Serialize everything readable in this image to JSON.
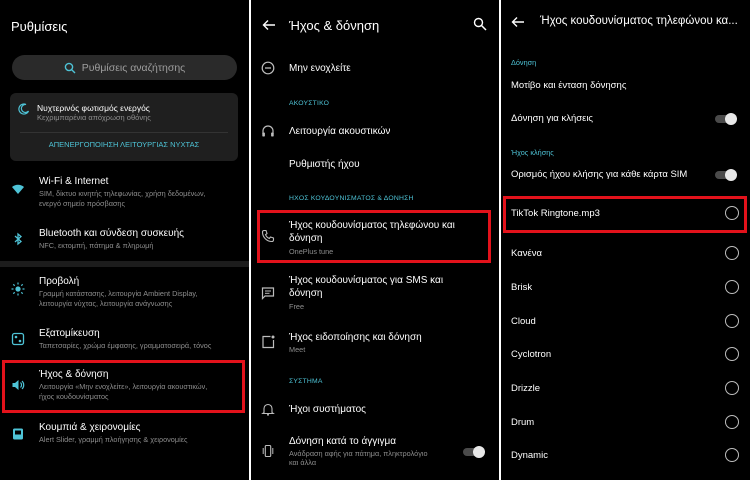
{
  "panel1": {
    "title": "Ρυθμίσεις",
    "search_placeholder": "Ρυθμίσεις αναζήτησης",
    "night_card": {
      "title": "Νυχτερινός φωτισμός ενεργός",
      "subtitle": "Κεχριμπαρένια απόχρωση οθόνης",
      "action": "ΑΠΕΝΕΡΓΟΠΟΙΗΣΗ ΛΕΙΤΟΥΡΓΙΑΣ ΝΥΧΤΑΣ"
    },
    "items": [
      {
        "title": "Wi-Fi & Internet",
        "sub1": "SIM, δίκτυο κινητής τηλεφωνίας, χρήση δεδομένων,",
        "sub2": "ενεργό σημείο πρόσβασης"
      },
      {
        "title": "Bluetooth και σύνδεση συσκευής",
        "sub1": "NFC, εκτομπή, πάτημα & πληρωμή",
        "sub2": ""
      },
      {
        "title": "Προβολή",
        "sub1": "Γραμμή κατάστασης, λειτουργία Ambient Display,",
        "sub2": "λειτουργία νύχτας, λειτουργία ανάγνωσης"
      },
      {
        "title": "Εξατομίκευση",
        "sub1": "Ταπετσαρίες, χρώμα έμφασης, γραμματοσειρά, τόνος",
        "sub2": ""
      },
      {
        "title": "Ήχος & δόνηση",
        "sub1": "Λειτουργία «Μην ενοχλείτε», λειτουργία ακουστικών,",
        "sub2": "ήχος κουδουνίσματος"
      },
      {
        "title": "Κουμπιά & χειρονομίες",
        "sub1": "Alert Slider, γραμμή πλοήγησης & χειρονομίες",
        "sub2": ""
      }
    ]
  },
  "panel2": {
    "title": "Ήχος & δόνηση",
    "dnd": "Μην ενοχλείτε",
    "sec_audio": "ΑΚΟΥΣΤΙΚΟ",
    "headphones": "Λειτουργία ακουστικών",
    "equalizer": "Ρυθμιστής ήχου",
    "sec_ring": "ΗΧΟΣ ΚΟΥΔΟΥΝΙΣΜΑΤΟΣ & ΔΟΝΗΣΗ",
    "ringtone_l1": "Ήχος κουδουνίσματος τηλεφώνου και",
    "ringtone_l2": "δόνηση",
    "ringtone_sub": "OnePlus tune",
    "sms_l1": "Ήχος κουδουνίσματος για SMS και",
    "sms_l2": "δόνηση",
    "sms_sub": "Free",
    "notif_title": "Ήχος ειδοποίησης και δόνηση",
    "notif_sub": "Meet",
    "sec_system": "ΣΥΣΤΗΜΑ",
    "system_sounds": "Ήχοι συστήματος",
    "touch_title": "Δόνηση κατά το άγγιγμα",
    "touch_sub1": "Ανάδραση αφής για πάτημα, πληκτρολόγιο",
    "touch_sub2": "και άλλα"
  },
  "panel3": {
    "title": "Ήχος κουδουνίσματος τηλεφώνου κα...",
    "sec_vibration": "Δόνηση",
    "vib_pattern": "Μοτίβο και ένταση δόνησης",
    "vib_calls": "Δόνηση για κλήσεις",
    "sec_ring": "Ήχος κλήσης",
    "per_sim": "Ορισμός ήχου κλήσης για κάθε κάρτα SIM",
    "ringtones": [
      "TikTok Ringtone.mp3",
      "Κανένα",
      "Brisk",
      "Cloud",
      "Cyclotron",
      "Drizzle",
      "Drum",
      "Dynamic"
    ]
  },
  "colors": {
    "accent": "#4ec3d6",
    "highlight": "#e3121b",
    "background": "#000000"
  }
}
